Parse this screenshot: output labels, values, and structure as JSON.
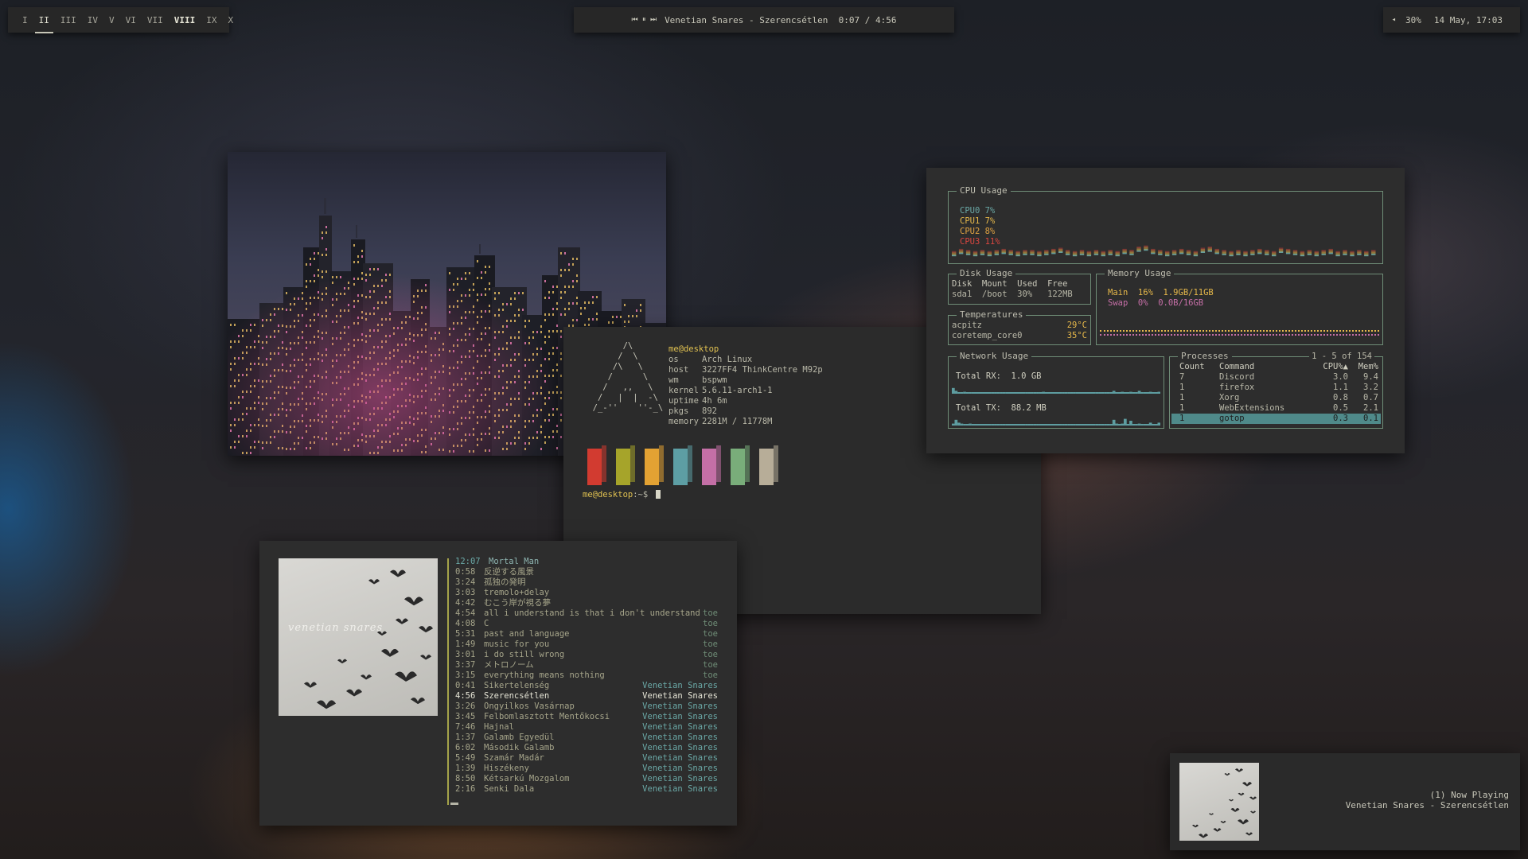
{
  "topbar": {
    "workspaces": [
      "I",
      "II",
      "III",
      "IV",
      "V",
      "VI",
      "VII",
      "VIII",
      "IX",
      "X"
    ],
    "media_controls": "⏮ ⏸ ⏭",
    "now_playing": "Venetian Snares - Szerencsétlen  0:07 / 4:56",
    "volume_icon": "◂",
    "volume": "30%",
    "datetime": "14 May, 17:03"
  },
  "terminal": {
    "user_host": "me@desktop",
    "info": [
      {
        "key": "os",
        "value": "Arch Linux"
      },
      {
        "key": "host",
        "value": "3227FF4 ThinkCentre M92p"
      },
      {
        "key": "wm",
        "value": "bspwm"
      },
      {
        "key": "kernel",
        "value": "5.6.11-arch1-1"
      },
      {
        "key": "uptime",
        "value": "4h 6m"
      },
      {
        "key": "pkgs",
        "value": "892"
      },
      {
        "key": "memory",
        "value": "2281M / 11778M"
      }
    ],
    "ascii_art": "        /\\\n       /  \\\n      /\\   \\\n     /      \\\n    /   ,,   \\\n   /   |  |  -\\\n  /_-''    ''-_\\",
    "prompt_user": "me@desktop",
    "prompt_suffix": ":~$",
    "palette": [
      "#d23b30",
      "#a6a42a",
      "#e3a233",
      "#5d9ea4",
      "#c46fa6",
      "#79ad7a",
      "#b7ad98"
    ]
  },
  "gotop": {
    "cpu_title": "CPU Usage",
    "cpus": [
      {
        "label": "CPU0 7%",
        "color": "#6aa8a6"
      },
      {
        "label": "CPU1 7%",
        "color": "#e6b84a"
      },
      {
        "label": "CPU2 8%",
        "color": "#e1a342"
      },
      {
        "label": "CPU3 11%",
        "color": "#d8463f"
      }
    ],
    "disk_title": "Disk Usage",
    "disk_headers": "Disk  Mount  Used  Free",
    "disk_row": "sda1  /boot  30%   122MB",
    "temp_title": "Temperatures",
    "temps": [
      {
        "name": "acpitz",
        "value": "29°C"
      },
      {
        "name": "coretemp_core0",
        "value": "35°C"
      }
    ],
    "memory_title": "Memory Usage",
    "mem_main": "Main  16%  1.9GB/11GB",
    "mem_swap": "Swap  0%  0.0B/16GB",
    "network_title": "Network Usage",
    "total_rx": "Total RX:  1.0 GB",
    "total_tx": "Total TX:  88.2 MB",
    "processes_title": "Processes",
    "process_count": "1 - 5 of 154",
    "process_headers": {
      "count": "Count",
      "command": "Command",
      "cpu": "CPU%▲",
      "mem": "Mem%"
    },
    "processes": [
      {
        "count": "7",
        "command": "Discord",
        "cpu": "3.0",
        "mem": "9.4"
      },
      {
        "count": "1",
        "command": "firefox",
        "cpu": "1.1",
        "mem": "3.2"
      },
      {
        "count": "1",
        "command": "Xorg",
        "cpu": "0.8",
        "mem": "0.7"
      },
      {
        "count": "1",
        "command": "WebExtensions",
        "cpu": "0.5",
        "mem": "2.1"
      },
      {
        "count": "1",
        "command": "gotop",
        "cpu": "0.3",
        "mem": "0.1"
      }
    ],
    "cpu_graph": [
      0.2,
      0.4,
      0.3,
      0.2,
      0.3,
      0.2,
      0.3,
      0.4,
      0.3,
      0.2,
      0.3,
      0.3,
      0.2,
      0.3,
      0.4,
      0.5,
      0.3,
      0.2,
      0.3,
      0.2,
      0.3,
      0.2,
      0.3,
      0.2,
      0.4,
      0.3,
      0.6,
      0.7,
      0.4,
      0.3,
      0.2,
      0.3,
      0.4,
      0.3,
      0.2,
      0.5,
      0.6,
      0.4,
      0.3,
      0.2,
      0.3,
      0.2,
      0.3,
      0.4,
      0.3,
      0.2,
      0.5,
      0.4,
      0.3,
      0.2,
      0.3,
      0.2,
      0.3,
      0.4,
      0.2,
      0.3,
      0.2,
      0.3,
      0.2,
      0.3
    ],
    "rx_graph": [
      0.6,
      0.3,
      0.1,
      0.1,
      0.2,
      0.1,
      0.1,
      0.1,
      0.1,
      0.1,
      0.1,
      0.1,
      0.1,
      0.1,
      0.1,
      0.1,
      0.1,
      0.1,
      0.1,
      0.1,
      0.1,
      0.1,
      0.1,
      0.1,
      0.1,
      0.1,
      0.1,
      0.1,
      0.1,
      0.1,
      0.1,
      0.1,
      0.2,
      0.1,
      0.1,
      0.1,
      0.1,
      0.1,
      0.1,
      0.1,
      0.1,
      0.1,
      0.1,
      0.1,
      0.1,
      0.1,
      0.1,
      0.1,
      0.1,
      0.1,
      0.1,
      0.1,
      0.1,
      0.1,
      0.1,
      0.1,
      0.1,
      0.3,
      0.1,
      0.1,
      0.2,
      0.1,
      0.1,
      0.2,
      0.1,
      0.1,
      0.3,
      0.1,
      0.1,
      0.1,
      0.2,
      0.1,
      0.1,
      0.2
    ],
    "tx_graph": [
      0.2,
      0.6,
      0.3,
      0.2,
      0.1,
      0.1,
      0.2,
      0.1,
      0.1,
      0.1,
      0.1,
      0.1,
      0.1,
      0.1,
      0.1,
      0.1,
      0.1,
      0.1,
      0.1,
      0.1,
      0.1,
      0.1,
      0.1,
      0.1,
      0.1,
      0.1,
      0.1,
      0.1,
      0.1,
      0.1,
      0.1,
      0.1,
      0.1,
      0.1,
      0.1,
      0.1,
      0.1,
      0.1,
      0.1,
      0.1,
      0.1,
      0.1,
      0.1,
      0.1,
      0.1,
      0.1,
      0.1,
      0.1,
      0.1,
      0.1,
      0.1,
      0.1,
      0.1,
      0.1,
      0.1,
      0.1,
      0.1,
      0.6,
      0.2,
      0.1,
      0.2,
      0.7,
      0.1,
      0.5,
      0.1,
      0.1,
      0.2,
      0.1,
      0.1,
      0.1,
      0.3,
      0.1,
      0.1,
      0.3
    ]
  },
  "music": {
    "tracks": [
      {
        "time": "12:07",
        "title": "Mortal Man",
        "artist": ""
      },
      {
        "time": "0:58",
        "title": "反逆する風景",
        "artist": ""
      },
      {
        "time": "3:24",
        "title": "孤独の発明",
        "artist": ""
      },
      {
        "time": "3:03",
        "title": "tremolo+delay",
        "artist": ""
      },
      {
        "time": "4:42",
        "title": "むこう岸が視る夢",
        "artist": ""
      },
      {
        "time": "4:54",
        "title": "all i understand is that i don't understand",
        "artist": "toe"
      },
      {
        "time": "4:08",
        "title": "C",
        "artist": "toe"
      },
      {
        "time": "5:31",
        "title": "past and language",
        "artist": "toe"
      },
      {
        "time": "1:49",
        "title": "music for you",
        "artist": "toe"
      },
      {
        "time": "3:01",
        "title": "i do still wrong",
        "artist": "toe"
      },
      {
        "time": "3:37",
        "title": "メトロノーム",
        "artist": "toe"
      },
      {
        "time": "3:15",
        "title": "everything means nothing",
        "artist": "toe"
      },
      {
        "time": "0:41",
        "title": "Sikertelenség",
        "artist": "Venetian Snares"
      },
      {
        "time": "4:56",
        "title": "Szerencsétlen",
        "artist": "Venetian Snares"
      },
      {
        "time": "3:26",
        "title": "Öngyilkos Vasárnap",
        "artist": "Venetian Snares"
      },
      {
        "time": "3:45",
        "title": "Felbomlasztott Mentőkocsi",
        "artist": "Venetian Snares"
      },
      {
        "time": "7:46",
        "title": "Hajnal",
        "artist": "Venetian Snares"
      },
      {
        "time": "1:37",
        "title": "Galamb Egyedül",
        "artist": "Venetian Snares"
      },
      {
        "time": "6:02",
        "title": "Második Galamb",
        "artist": "Venetian Snares"
      },
      {
        "time": "5:49",
        "title": "Szamár Madár",
        "artist": "Venetian Snares"
      },
      {
        "time": "1:39",
        "title": "Hiszékeny",
        "artist": "Venetian Snares"
      },
      {
        "time": "8:50",
        "title": "Kétsarkú Mozgalom",
        "artist": "Venetian Snares"
      },
      {
        "time": "2:16",
        "title": "Senki Dala",
        "artist": "Venetian Snares"
      }
    ],
    "current_index": 13,
    "album_text": "venetian snares"
  },
  "now_playing_popup": {
    "line1": "(1) Now Playing",
    "line2": "Venetian Snares - Szerencsétlen"
  }
}
